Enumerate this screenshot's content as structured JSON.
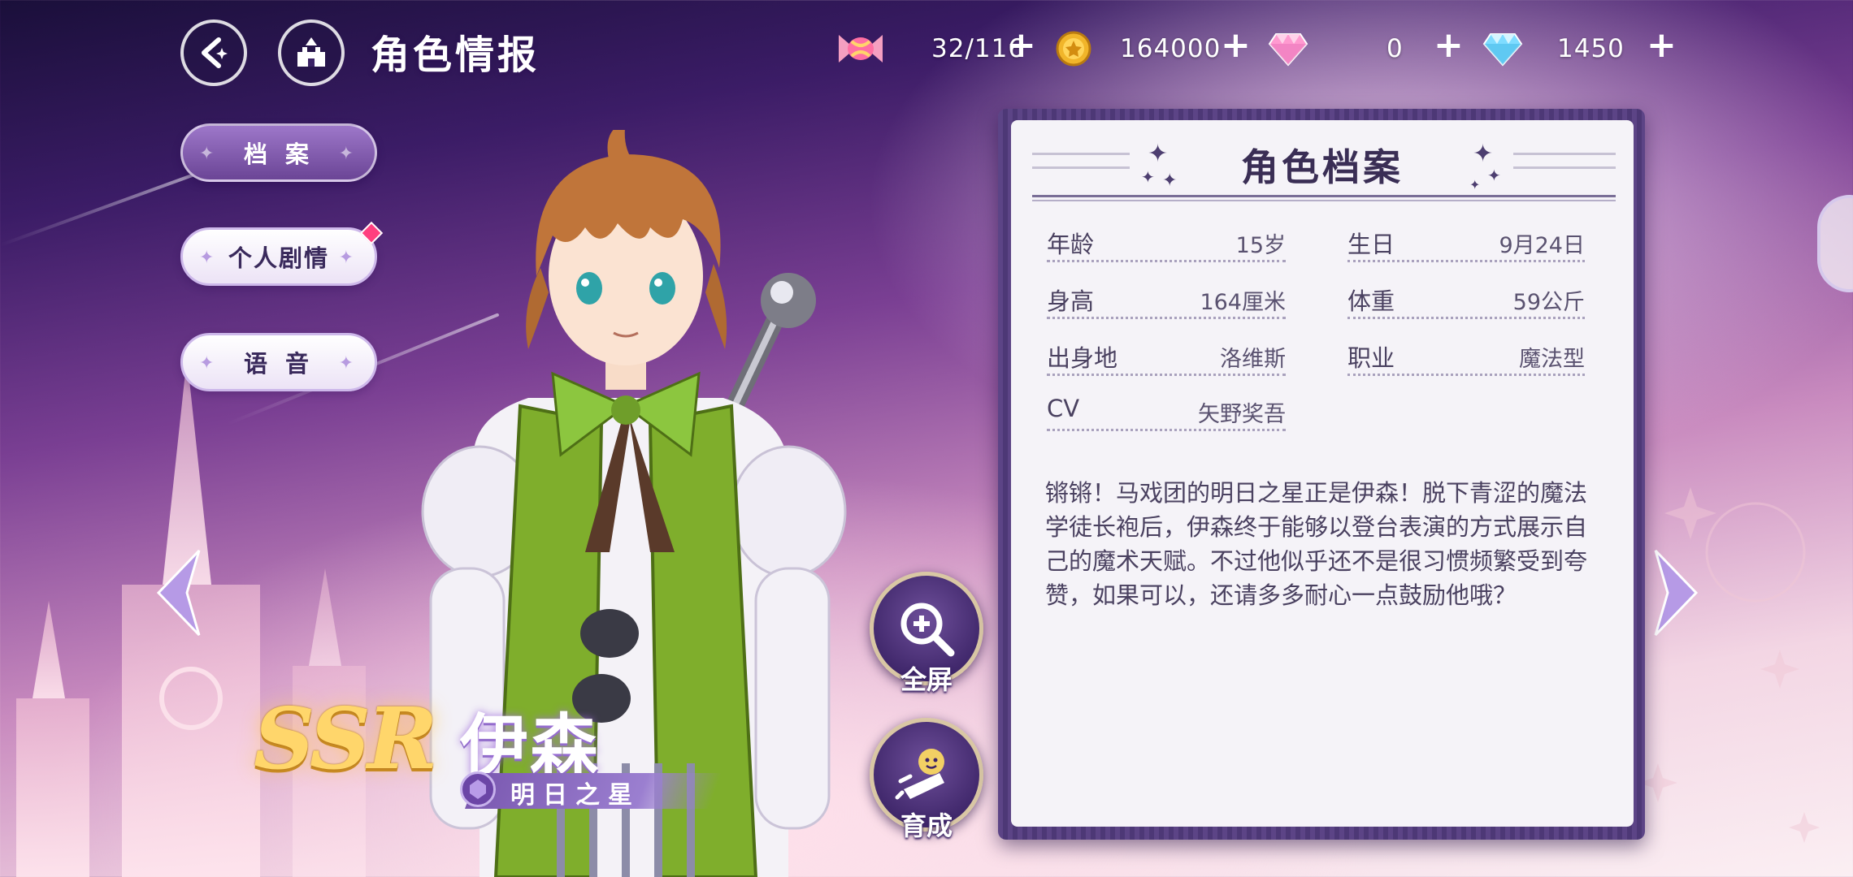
{
  "header": {
    "title": "角色情报",
    "currencies": [
      {
        "icon": "candy-icon",
        "value": "32/116"
      },
      {
        "icon": "gold-coin-icon",
        "value": "164000"
      },
      {
        "icon": "pink-diamond-icon",
        "value": "0"
      },
      {
        "icon": "blue-diamond-icon",
        "value": "1450"
      }
    ]
  },
  "menu": {
    "items": [
      {
        "label": "档 案",
        "active": true
      },
      {
        "label": "个人剧情",
        "active": false,
        "badge": true
      },
      {
        "label": "语 音",
        "active": false
      }
    ]
  },
  "character": {
    "rarity": "SSR",
    "name": "伊森",
    "title": "明日之星"
  },
  "actions": {
    "fullscreen": "全屏",
    "develop": "育成"
  },
  "profile": {
    "heading": "角色档案",
    "fields": {
      "age": {
        "label": "年龄",
        "value": "15岁"
      },
      "birthday": {
        "label": "生日",
        "value": "9月24日"
      },
      "height": {
        "label": "身高",
        "value": "164厘米"
      },
      "weight": {
        "label": "体重",
        "value": "59公斤"
      },
      "origin": {
        "label": "出身地",
        "value": "洛维斯"
      },
      "job": {
        "label": "职业",
        "value": "魔法型"
      },
      "cv": {
        "label": "CV",
        "value": "矢野奖吾"
      }
    },
    "description": "锵锵！马戏团的明日之星正是伊森！脱下青涩的魔法学徒长袍后，伊森终于能够以登台表演的方式展示自己的魔术天赋。不过他似乎还不是很习惯频繁受到夸赞，如果可以，还请多多耐心一点鼓励他哦？"
  },
  "colors": {
    "accent_purple": "#6b4596",
    "panel_bg": "#f5f3f8",
    "rarity_gold": "#ffd66b",
    "badge_pink": "#ff3f7f"
  }
}
